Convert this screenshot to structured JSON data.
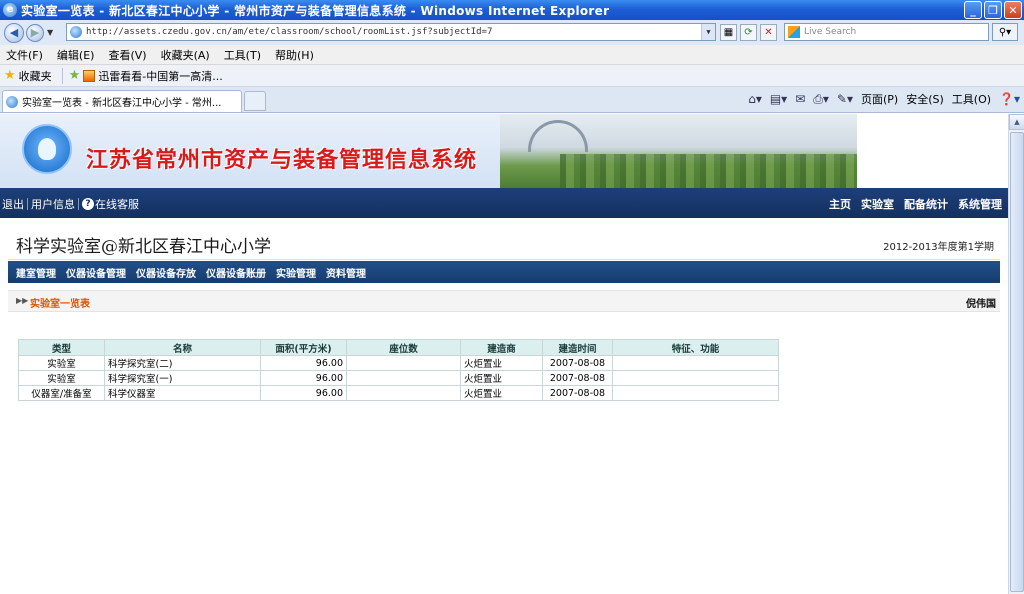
{
  "window": {
    "title": "实验室一览表 - 新北区春江中心小学 - 常州市资产与装备管理信息系统 - Windows Internet Explorer"
  },
  "address": {
    "url": "http://assets.czedu.gov.cn/am/ete/classroom/school/roomList.jsf?subjectId=7",
    "search_placeholder": "Live Search"
  },
  "menu": [
    "文件(F)",
    "编辑(E)",
    "查看(V)",
    "收藏夹(A)",
    "工具(T)",
    "帮助(H)"
  ],
  "favorites": {
    "label": "收藏夹",
    "items": [
      "迅雷看看-中国第一高清..."
    ]
  },
  "tab": {
    "label": "实验室一览表 - 新北区春江中心小学 - 常州..."
  },
  "commands": {
    "page": "页面(P)",
    "safety": "安全(S)",
    "tools": "工具(O)"
  },
  "banner": {
    "title": "江苏省常州市资产与装备管理信息系统"
  },
  "topnav": {
    "left": [
      "退出",
      "用户信息"
    ],
    "online": "在线客服",
    "right": [
      "主页",
      "实验室",
      "配备统计",
      "系统管理"
    ]
  },
  "section": {
    "name": "科学实验室@新北区春江中心小学",
    "term": "2012-2013年度第1学期"
  },
  "subnav": [
    "建室管理",
    "仪器设备管理",
    "仪器设备存放",
    "仪器设备账册",
    "实验管理",
    "资料管理"
  ],
  "breadcrumb": {
    "title": "实验室一览表",
    "action": "倪伟国"
  },
  "table": {
    "headers": [
      "类型",
      "名称",
      "面积(平方米)",
      "座位数",
      "建造商",
      "建造时间",
      "特征、功能"
    ],
    "rows": [
      [
        "实验室",
        "科学探究室(二)",
        "96.00",
        "",
        "火炬置业",
        "2007-08-08",
        ""
      ],
      [
        "实验室",
        "科学探究室(一)",
        "96.00",
        "",
        "火炬置业",
        "2007-08-08",
        ""
      ],
      [
        "仪器室/准备室",
        "科学仪器室",
        "96.00",
        "",
        "火炬置业",
        "2007-08-08",
        ""
      ]
    ]
  }
}
